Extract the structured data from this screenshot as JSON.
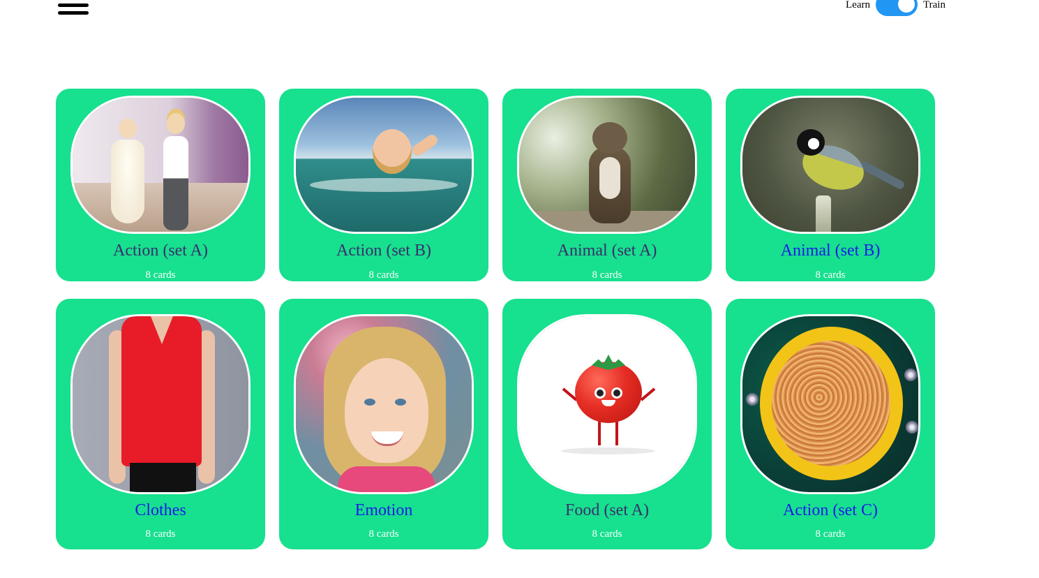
{
  "header": {
    "menu_icon": "hamburger-menu-icon",
    "mode_toggle": {
      "left_label": "Learn",
      "right_label": "Train",
      "state": "on",
      "accent_color": "#2196f3"
    }
  },
  "theme": {
    "card_color": "#17e08f",
    "title_color": "#3b2f6b",
    "link_color": "#1a1ae8"
  },
  "categories": [
    {
      "title": "Action (set A)",
      "count": "8 cards",
      "image": "children-dancing"
    },
    {
      "title": "Action (set B)",
      "count": "8 cards",
      "image": "child-swimming"
    },
    {
      "title": "Animal (set A)",
      "count": "8 cards",
      "image": "cat"
    },
    {
      "title": "Animal (set B)",
      "count": "8 cards",
      "image": "bird"
    },
    {
      "title": "Clothes",
      "count": "8 cards",
      "image": "red-blouse"
    },
    {
      "title": "Emotion",
      "count": "8 cards",
      "image": "smiling-girl"
    },
    {
      "title": "Food (set A)",
      "count": "8 cards",
      "image": "tomato-cartoon"
    },
    {
      "title": "Action (set C)",
      "count": "8 cards",
      "image": "noodles-plate"
    }
  ]
}
